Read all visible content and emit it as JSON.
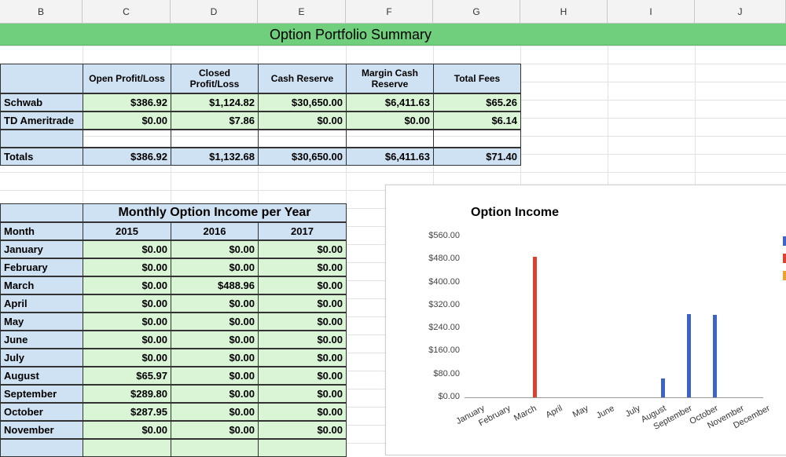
{
  "columns": [
    "B",
    "C",
    "D",
    "E",
    "F",
    "G",
    "H",
    "I",
    "J"
  ],
  "banner_title": "Option Portfolio Summary",
  "summary": {
    "headers": [
      "Open Profit/Loss",
      "Closed Profit/Loss",
      "Cash Reserve",
      "Margin Cash Reserve",
      "Total Fees"
    ],
    "rows": [
      {
        "label": "Schwab",
        "values": [
          "$386.92",
          "$1,124.82",
          "$30,650.00",
          "$6,411.63",
          "$65.26"
        ]
      },
      {
        "label": "TD Ameritrade",
        "values": [
          "$0.00",
          "$7.86",
          "$0.00",
          "$0.00",
          "$6.14"
        ]
      }
    ],
    "totals": {
      "label": "Totals",
      "values": [
        "$386.92",
        "$1,132.68",
        "$30,650.00",
        "$6,411.63",
        "$71.40"
      ]
    }
  },
  "monthly": {
    "title": "Monthly Option Income per Year",
    "month_header": "Month",
    "years": [
      "2015",
      "2016",
      "2017"
    ],
    "rows": [
      {
        "month": "January",
        "values": [
          "$0.00",
          "$0.00",
          "$0.00"
        ]
      },
      {
        "month": "February",
        "values": [
          "$0.00",
          "$0.00",
          "$0.00"
        ]
      },
      {
        "month": "March",
        "values": [
          "$0.00",
          "$488.96",
          "$0.00"
        ]
      },
      {
        "month": "April",
        "values": [
          "$0.00",
          "$0.00",
          "$0.00"
        ]
      },
      {
        "month": "May",
        "values": [
          "$0.00",
          "$0.00",
          "$0.00"
        ]
      },
      {
        "month": "June",
        "values": [
          "$0.00",
          "$0.00",
          "$0.00"
        ]
      },
      {
        "month": "July",
        "values": [
          "$0.00",
          "$0.00",
          "$0.00"
        ]
      },
      {
        "month": "August",
        "values": [
          "$65.97",
          "$0.00",
          "$0.00"
        ]
      },
      {
        "month": "September",
        "values": [
          "$289.80",
          "$0.00",
          "$0.00"
        ]
      },
      {
        "month": "October",
        "values": [
          "$287.95",
          "$0.00",
          "$0.00"
        ]
      },
      {
        "month": "November",
        "values": [
          "$0.00",
          "$0.00",
          "$0.00"
        ]
      }
    ]
  },
  "chart_data": {
    "type": "bar",
    "title": "Option Income",
    "categories": [
      "January",
      "February",
      "March",
      "April",
      "May",
      "June",
      "July",
      "August",
      "September",
      "October",
      "November",
      "December"
    ],
    "series": [
      {
        "values": [
          0,
          0,
          0,
          0,
          0,
          0,
          0,
          65.97,
          289.8,
          287.95,
          0,
          0
        ],
        "color": "#3b64c4"
      },
      {
        "values": [
          0,
          0,
          488.96,
          0,
          0,
          0,
          0,
          0,
          0,
          0,
          0,
          0
        ],
        "color": "#d9432f"
      },
      {
        "values": [
          0,
          0,
          0,
          0,
          0,
          0,
          0,
          0,
          0,
          0,
          0,
          0
        ],
        "color": "#f0a030"
      }
    ],
    "yticks": [
      "$560.00",
      "$480.00",
      "$400.00",
      "$320.00",
      "$240.00",
      "$160.00",
      "$80.00",
      "$0.00"
    ],
    "ylim": [
      0,
      560
    ],
    "legend": "right"
  }
}
